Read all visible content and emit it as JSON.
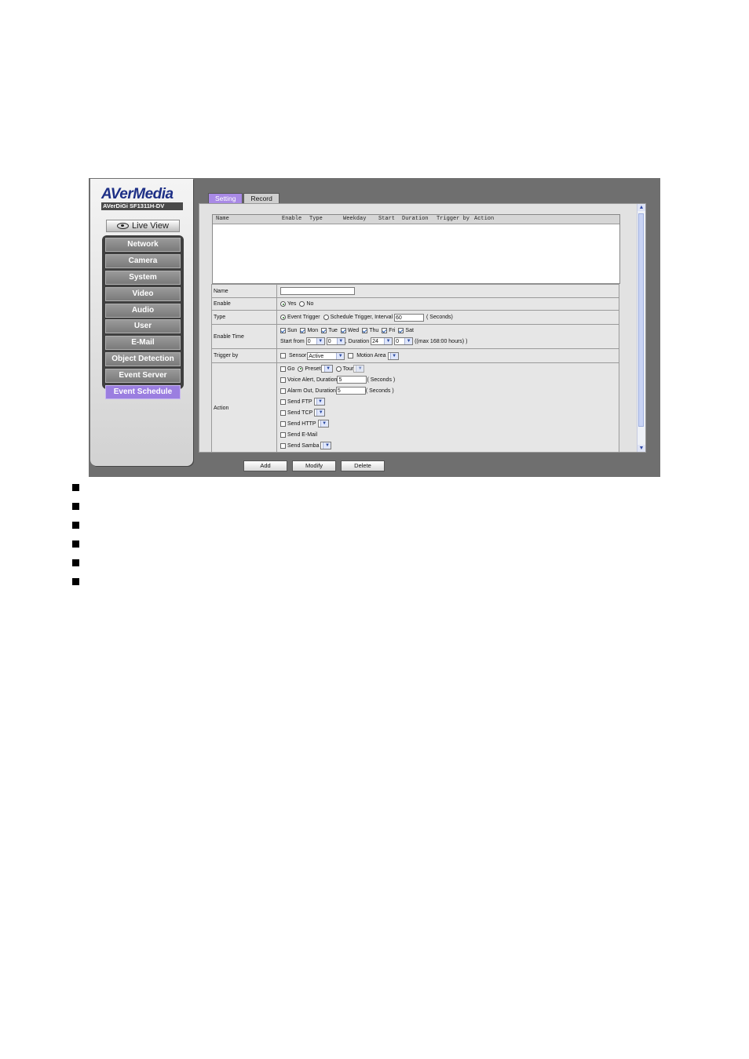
{
  "brand": {
    "logo": "AVerMedia",
    "model": "AVerDiGi SF1311H-DV"
  },
  "sidebar": {
    "live_view": "Live View",
    "items": [
      {
        "label": "Network"
      },
      {
        "label": "Camera"
      },
      {
        "label": "System"
      },
      {
        "label": "Video"
      },
      {
        "label": "Audio"
      },
      {
        "label": "User"
      },
      {
        "label": "E-Mail"
      },
      {
        "label": "Object Detection"
      },
      {
        "label": "Event Server"
      },
      {
        "label": "Event Schedule",
        "active": true
      }
    ]
  },
  "tabs": {
    "setting": "Setting",
    "record": "Record",
    "selected": "Setting"
  },
  "list": {
    "columns": [
      "Name",
      "Enable",
      "Type",
      "Weekday",
      "Start",
      "Duration",
      "Trigger by",
      "Action"
    ],
    "rows": []
  },
  "form": {
    "name": {
      "label": "Name",
      "value": ""
    },
    "enable": {
      "label": "Enable",
      "yes": "Yes",
      "no": "No",
      "selected": "Yes"
    },
    "type": {
      "label": "Type",
      "event": "Event Trigger",
      "schedule": "Schedule Trigger, Interval",
      "interval": "60",
      "unit": "( Seconds)",
      "selected": "Event Trigger"
    },
    "enable_time": {
      "label": "Enable Time",
      "days": [
        {
          "label": "Sun",
          "checked": true
        },
        {
          "label": "Mon",
          "checked": true
        },
        {
          "label": "Tue",
          "checked": true
        },
        {
          "label": "Wed",
          "checked": true
        },
        {
          "label": "Thu",
          "checked": true
        },
        {
          "label": "Fri",
          "checked": true
        },
        {
          "label": "Sat",
          "checked": true
        }
      ],
      "start_label": "Start from",
      "start_hour": "0",
      "start_min": "0",
      "duration_label": ", Duration",
      "duration_hour": "24",
      "duration_min": "0",
      "max_note": "((max 168:00 hours) )"
    },
    "trigger_by": {
      "label": "Trigger by",
      "sensor": "Sensor",
      "sensor_value": "Active",
      "motion": "Motion Area",
      "motion_value": ""
    },
    "action": {
      "label": "Action",
      "go": "Go",
      "preset": "Preset",
      "tour": "Tour",
      "voice": "Voice Alert, Duration",
      "voice_value": "5",
      "voice_unit": "( Seconds )",
      "alarm": "Alarm Out, Duration",
      "alarm_value": "5",
      "alarm_unit": "( Seconds )",
      "ftp": "Send FTP",
      "tcp": "Send TCP",
      "http": "Send HTTP",
      "email": "Send E-Mail",
      "samba": "Send Samba"
    }
  },
  "buttons": {
    "add": "Add",
    "modify": "Modify",
    "delete": "Delete"
  },
  "colors": {
    "accent": "#a98ae6",
    "background": "#6f6f6f",
    "panel": "#e2e2e2"
  }
}
